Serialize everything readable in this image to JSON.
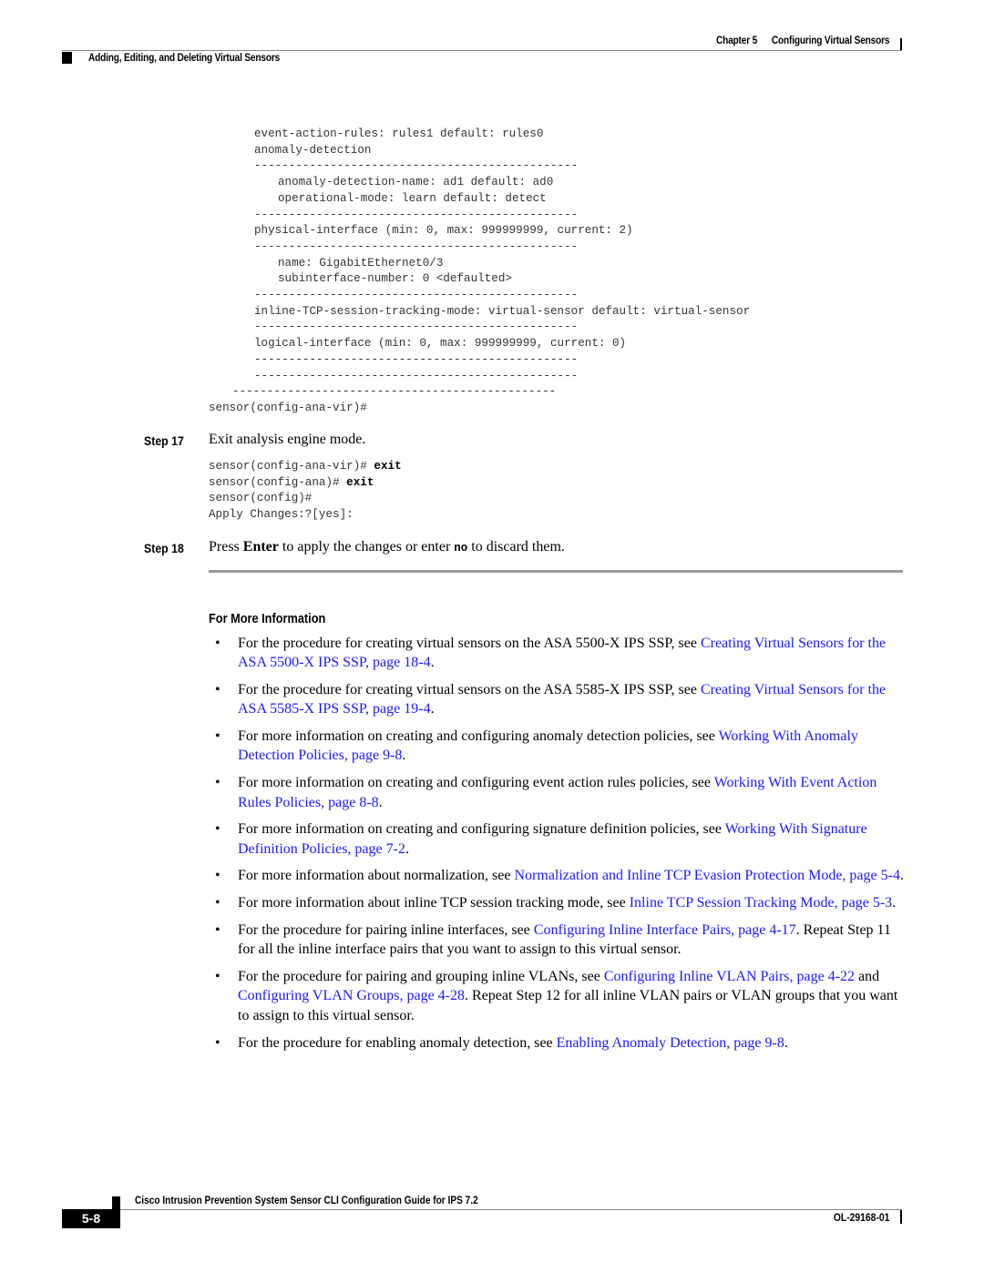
{
  "header": {
    "chapter_label": "Chapter 5",
    "chapter_title": "Configuring Virtual Sensors",
    "section_title": "Adding, Editing, and Deleting Virtual Sensors"
  },
  "code_block_1": {
    "lines": [
      {
        "indent": 2,
        "text": "event-action-rules: rules1 default: rules0"
      },
      {
        "indent": 2,
        "text": "anomaly-detection"
      },
      {
        "indent": 2,
        "text": "-----------------------------------------------"
      },
      {
        "indent": 3,
        "text": "anomaly-detection-name: ad1 default: ad0"
      },
      {
        "indent": 3,
        "text": "operational-mode: learn default: detect"
      },
      {
        "indent": 2,
        "text": "-----------------------------------------------"
      },
      {
        "indent": 2,
        "text": "physical-interface (min: 0, max: 999999999, current: 2)"
      },
      {
        "indent": 2,
        "text": "-----------------------------------------------"
      },
      {
        "indent": 3,
        "text": "name: GigabitEthernet0/3"
      },
      {
        "indent": 3,
        "text": "subinterface-number: 0 <defaulted>"
      },
      {
        "indent": 2,
        "text": "-----------------------------------------------"
      },
      {
        "indent": 2,
        "text": "inline-TCP-session-tracking-mode: virtual-sensor default: virtual-sensor"
      },
      {
        "indent": 2,
        "text": "-----------------------------------------------"
      },
      {
        "indent": 2,
        "text": "logical-interface (min: 0, max: 999999999, current: 0)"
      },
      {
        "indent": 2,
        "text": "-----------------------------------------------"
      },
      {
        "indent": 2,
        "text": "-----------------------------------------------"
      },
      {
        "indent": 1,
        "text": "-----------------------------------------------"
      },
      {
        "indent": 0,
        "text": "sensor(config-ana-vir)#"
      }
    ]
  },
  "step17": {
    "label": "Step 17",
    "text": "Exit analysis engine mode.",
    "code": [
      {
        "prompt": "sensor(config-ana-vir)# ",
        "cmd": "exit"
      },
      {
        "prompt": "sensor(config-ana)# ",
        "cmd": "exit"
      },
      {
        "prompt": "sensor(config)#",
        "cmd": ""
      },
      {
        "prompt": "Apply Changes:?[yes]:",
        "cmd": ""
      }
    ]
  },
  "step18": {
    "label": "Step 18",
    "text_1": "Press ",
    "bold": "Enter",
    "text_2": " to apply the changes or enter ",
    "code": "no",
    "text_3": " to discard them."
  },
  "for_more_info": {
    "title": "For More Information",
    "bullet_glyph": "•",
    "items": [
      {
        "parts": [
          {
            "t": "For the procedure for creating virtual sensors on the ASA 5500-X IPS SSP, see "
          },
          {
            "t": "Creating Virtual Sensors for the ASA 5500-X IPS SSP, page 18-4",
            "link": true
          },
          {
            "t": "."
          }
        ]
      },
      {
        "parts": [
          {
            "t": "For the procedure for creating virtual sensors on the ASA 5585-X IPS SSP, see "
          },
          {
            "t": "Creating Virtual Sensors for the ASA 5585-X IPS SSP, page 19-4",
            "link": true
          },
          {
            "t": "."
          }
        ]
      },
      {
        "parts": [
          {
            "t": "For more information on creating and configuring anomaly detection policies, see "
          },
          {
            "t": "Working With Anomaly Detection Policies, page 9-8",
            "link": true
          },
          {
            "t": "."
          }
        ]
      },
      {
        "parts": [
          {
            "t": "For more information on creating and configuring event action rules policies, see "
          },
          {
            "t": "Working With Event Action Rules Policies, page 8-8",
            "link": true
          },
          {
            "t": "."
          }
        ]
      },
      {
        "parts": [
          {
            "t": "For more information on creating and configuring signature definition policies, see "
          },
          {
            "t": "Working With Signature Definition Policies, page 7-2",
            "link": true
          },
          {
            "t": "."
          }
        ]
      },
      {
        "parts": [
          {
            "t": "For more information about normalization, see "
          },
          {
            "t": "Normalization and Inline TCP Evasion Protection Mode, page 5-4",
            "link": true
          },
          {
            "t": "."
          }
        ]
      },
      {
        "parts": [
          {
            "t": "For more information about inline TCP session tracking mode, see "
          },
          {
            "t": "Inline TCP Session Tracking Mode, page 5-3",
            "link": true
          },
          {
            "t": "."
          }
        ]
      },
      {
        "parts": [
          {
            "t": "For the procedure for pairing inline interfaces, see "
          },
          {
            "t": "Configuring Inline Interface Pairs, page 4-17",
            "link": true
          },
          {
            "t": ". Repeat Step 11 for all the inline interface pairs that you want to assign to this virtual sensor."
          }
        ]
      },
      {
        "parts": [
          {
            "t": "For the procedure for pairing and grouping inline VLANs, see "
          },
          {
            "t": "Configuring Inline VLAN Pairs, page 4-22",
            "link": true
          },
          {
            "t": " and "
          },
          {
            "t": "Configuring VLAN Groups, page 4-28",
            "link": true
          },
          {
            "t": ". Repeat Step 12 for all inline VLAN pairs or VLAN groups that you want to assign to this virtual sensor."
          }
        ]
      },
      {
        "parts": [
          {
            "t": "For the procedure for enabling anomaly detection, see "
          },
          {
            "t": "Enabling Anomaly Detection, page 9-8",
            "link": true
          },
          {
            "t": "."
          }
        ]
      }
    ]
  },
  "footer": {
    "guide_title": "Cisco Intrusion Prevention System Sensor CLI Configuration Guide for IPS 7.2",
    "page_number": "5-8",
    "doc_number": "OL-29168-01"
  },
  "colors": {
    "link": "#1a1aff",
    "rule": "#9a9a9a",
    "code_text": "#333333"
  }
}
